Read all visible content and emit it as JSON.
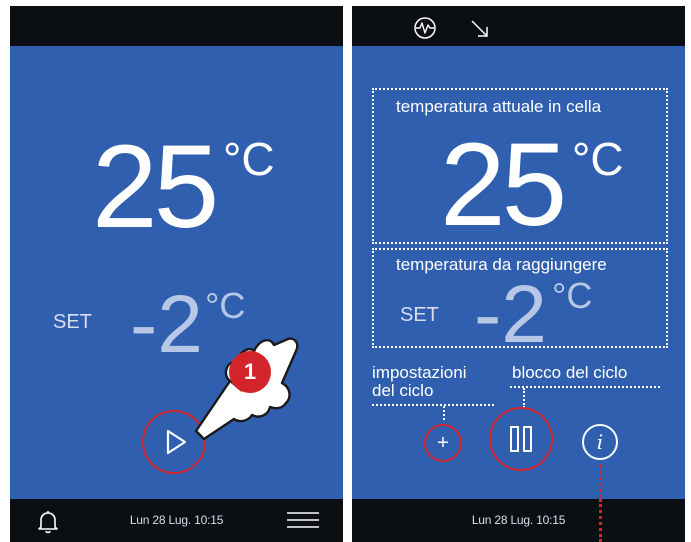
{
  "left": {
    "current_temp_value": "25",
    "current_temp_unit": "°C",
    "set_label": "SET",
    "set_temp_value": "-2",
    "set_temp_unit": "°C",
    "step_badge": "1",
    "datetime": "Lun 28 Lug. 10:15"
  },
  "right": {
    "current_temp_caption": "temperatura attuale in cella",
    "current_temp_value": "25",
    "current_temp_unit": "°C",
    "target_temp_caption": "temperatura da raggiungere",
    "set_label": "SET",
    "set_temp_value": "-2",
    "set_temp_unit": "°C",
    "cycle_settings_caption_line1": "impostazioni",
    "cycle_settings_caption_line2": "del ciclo",
    "cycle_lock_caption": "blocco del ciclo",
    "plus_symbol": "+",
    "info_symbol": "i",
    "datetime": "Lun 28 Lug. 10:15"
  },
  "colors": {
    "screen_bg": "#2f5fae",
    "bar_bg": "#0b0f14",
    "highlight_red": "#d3242c",
    "set_text": "#b7c8e6"
  },
  "icons": [
    "bell-icon",
    "hamburger-menu-icon",
    "play-icon",
    "tap-hand-icon",
    "activity-wave-icon",
    "arrow-down-right-icon",
    "pause-icon",
    "plus-icon",
    "info-icon"
  ]
}
